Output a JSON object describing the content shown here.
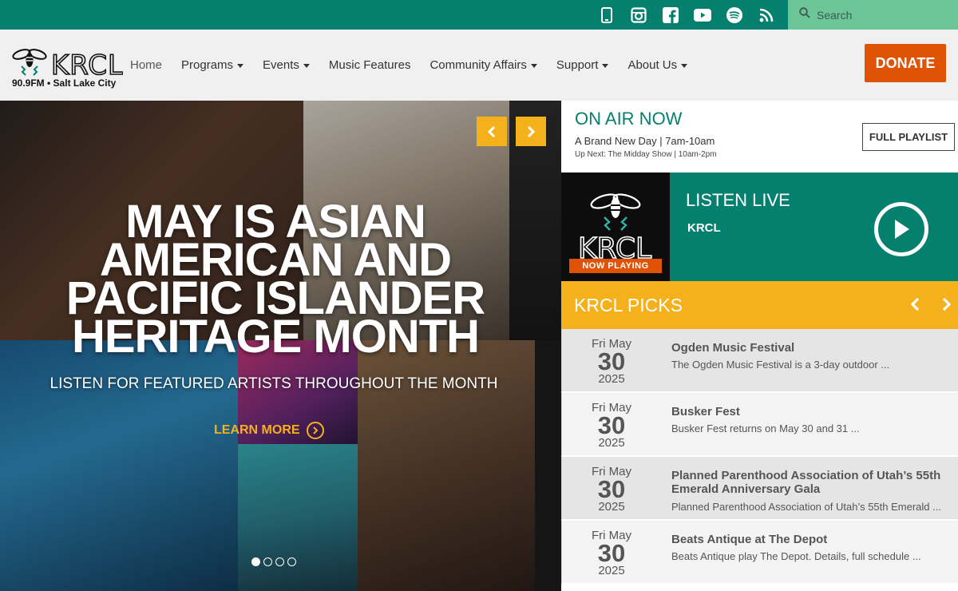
{
  "search": {
    "placeholder": "Search"
  },
  "social": [
    "mobile-icon",
    "instagram-icon",
    "facebook-icon",
    "youtube-icon",
    "spotify-icon",
    "rss-icon"
  ],
  "logo": {
    "name": "KRCL",
    "tagline": "90.9FM • Salt Lake City"
  },
  "nav": {
    "items": [
      {
        "label": "Home",
        "dropdown": false
      },
      {
        "label": "Programs",
        "dropdown": true
      },
      {
        "label": "Events",
        "dropdown": true
      },
      {
        "label": "Music Features",
        "dropdown": false
      },
      {
        "label": "Community Affairs",
        "dropdown": true
      },
      {
        "label": "Support",
        "dropdown": true
      },
      {
        "label": "About Us",
        "dropdown": true
      }
    ],
    "donate": "DONATE"
  },
  "hero": {
    "title_lines": [
      "MAY IS ASIAN",
      "AMERICAN AND",
      "PACIFIC ISLANDER",
      "HERITAGE MONTH"
    ],
    "subtitle": "LISTEN FOR FEATURED ARTISTS THROUGHOUT THE MONTH",
    "cta": "LEARN MORE",
    "slide_count": 4,
    "active_slide": 1
  },
  "on_air": {
    "heading": "ON AIR NOW",
    "show": "A Brand New Day | 7am-10am",
    "up_next": "Up Next: The Midday Show | 10am-2pm",
    "playlist_button": "FULL PLAYLIST"
  },
  "listen_live": {
    "heading": "LISTEN LIVE",
    "station": "KRCL",
    "badge": "NOW PLAYING",
    "logo_text": "KRCL"
  },
  "picks": {
    "heading": "KRCL PICKS",
    "items": [
      {
        "month": "Fri May",
        "day": "30",
        "year": "2025",
        "title": "Ogden Music Festival",
        "desc": "The Ogden Music Festival is a 3-day outdoor ..."
      },
      {
        "month": "Fri May",
        "day": "30",
        "year": "2025",
        "title": "Busker Fest",
        "desc": "Busker Fest returns on May 30 and 31 ..."
      },
      {
        "month": "Fri May",
        "day": "30",
        "year": "2025",
        "title": "Planned Parenthood Association of Utah’s 55th Emerald Anniversary Gala",
        "desc": "Planned Parenthood Association of Utah’s 55th Emerald ..."
      },
      {
        "month": "Fri May",
        "day": "30",
        "year": "2025",
        "title": "Beats Antique at The Depot",
        "desc": "Beats Antique play The Depot. Details, full schedule ..."
      }
    ]
  },
  "colors": {
    "teal": "#05806f",
    "mint": "#6cc596",
    "orange": "#e05204",
    "gold": "#f5b11c"
  }
}
